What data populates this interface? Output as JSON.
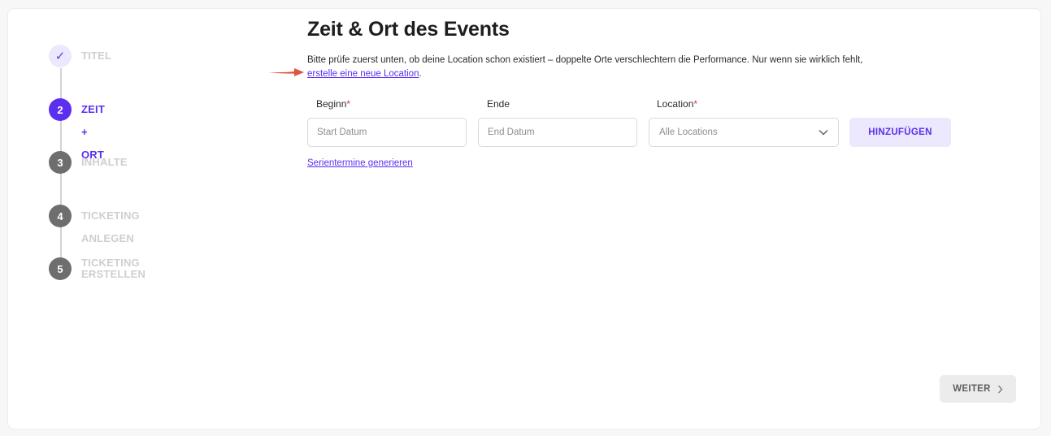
{
  "stepper": {
    "steps": [
      {
        "number": "✓",
        "label": "TITEL",
        "state": "done"
      },
      {
        "number": "2",
        "label": "ZEIT + ORT",
        "state": "active"
      },
      {
        "number": "3",
        "label": "INHALTE",
        "state": "todo"
      },
      {
        "number": "4",
        "label": "TICKETING ANLEGEN",
        "state": "todo"
      },
      {
        "number": "5",
        "label": "TICKETING ERSTELLEN",
        "sublabel": "...",
        "state": "todo"
      }
    ]
  },
  "main": {
    "title": "Zeit & Ort des Events",
    "intro_text": "Bitte prüfe zuerst unten, ob deine Location schon existiert – doppelte Orte verschlechtern die Performance. Nur wenn sie wirklich fehlt,",
    "intro_link": "erstelle eine neue Location",
    "intro_end": ".",
    "fields": {
      "start": {
        "label": "Beginn",
        "required_mark": "*",
        "placeholder": "Start Datum"
      },
      "end": {
        "label": "Ende",
        "placeholder": "End Datum"
      },
      "location": {
        "label": "Location",
        "required_mark": "*",
        "selected": "Alle Locations"
      }
    },
    "add_button": "HINZUFÜGEN",
    "series_link": "Serientermine generieren",
    "next_button": "WEITER"
  },
  "colors": {
    "accent": "#5b2ff0",
    "accent_light": "#ece8fd",
    "annotation_arrow": "#e0533c"
  },
  "icons": {
    "done_step": "check-icon",
    "dropdown": "chevron-down-icon",
    "next": "chevron-right-icon"
  }
}
